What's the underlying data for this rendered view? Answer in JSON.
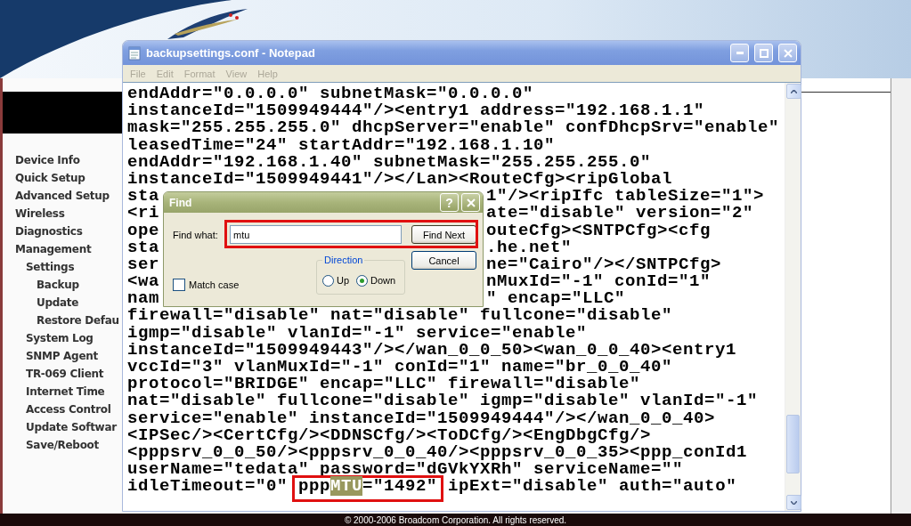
{
  "page": {
    "nav": [
      {
        "label": "Device Info"
      },
      {
        "label": "Quick Setup"
      },
      {
        "label": "Advanced Setup"
      },
      {
        "label": "Wireless"
      },
      {
        "label": "Diagnostics"
      },
      {
        "label": "Management",
        "children": [
          {
            "label": "Settings",
            "children": [
              {
                "label": "Backup"
              },
              {
                "label": "Update"
              },
              {
                "label": "Restore Defau"
              }
            ]
          },
          {
            "label": "System Log"
          },
          {
            "label": "SNMP Agent"
          },
          {
            "label": "TR-069 Client"
          },
          {
            "label": "Internet Time"
          },
          {
            "label": "Access Control"
          },
          {
            "label": "Update Softwar"
          },
          {
            "label": "Save/Reboot"
          }
        ]
      }
    ],
    "footer": "© 2000-2006 Broadcom Corporation. All rights reserved."
  },
  "notepad": {
    "title": "backupsettings.conf - Notepad",
    "menu": [
      "File",
      "Edit",
      "Format",
      "View",
      "Help"
    ],
    "lines": [
      {
        "kind": "full",
        "text": "endAddr=\"0.0.0.0\" subnetMask=\"0.0.0.0\""
      },
      {
        "kind": "full",
        "text": "instanceId=\"1509949444\"/><entry1 address=\"192.168.1.1\""
      },
      {
        "kind": "full",
        "text": "mask=\"255.255.255.0\" dhcpServer=\"enable\" confDhcpSrv=\"enable\""
      },
      {
        "kind": "full",
        "text": "leasedTime=\"24\" startAddr=\"192.168.1.10\""
      },
      {
        "kind": "full",
        "text": "endAddr=\"192.168.1.40\" subnetMask=\"255.255.255.0\""
      },
      {
        "kind": "full",
        "text": "instanceId=\"1509949441\"/></Lan><RouteCfg><ripGlobal"
      },
      {
        "kind": "split",
        "left": "sta",
        "right": "1\"/><ripIfc tableSize=\"1\">"
      },
      {
        "kind": "split",
        "left": "<ri",
        "right": "ate=\"disable\" version=\"2\""
      },
      {
        "kind": "split",
        "left": "ope",
        "right": "outeCfg><SNTPCfg><cfg"
      },
      {
        "kind": "split",
        "left": "sta",
        "right": ".he.net\""
      },
      {
        "kind": "split",
        "left": "ser",
        "right": "ne=\"Cairo\"/></SNTPCfg>"
      },
      {
        "kind": "split",
        "left": "<wa",
        "right": "nMuxId=\"-1\" conId=\"1\""
      },
      {
        "kind": "split",
        "left": "nam",
        "right": "\" encap=\"LLC\""
      },
      {
        "kind": "full",
        "text": "firewall=\"disable\" nat=\"disable\" fullcone=\"disable\""
      },
      {
        "kind": "full",
        "text": "igmp=\"disable\" vlanId=\"-1\" service=\"enable\""
      },
      {
        "kind": "full",
        "text": "instanceId=\"1509949443\"/></wan_0_0_50><wan_0_0_40><entry1"
      },
      {
        "kind": "full",
        "text": "vccId=\"3\" vlanMuxId=\"-1\" conId=\"1\" name=\"br_0_0_40\""
      },
      {
        "kind": "full",
        "text": "protocol=\"BRIDGE\" encap=\"LLC\" firewall=\"disable\""
      },
      {
        "kind": "full",
        "text": "nat=\"disable\" fullcone=\"disable\" igmp=\"disable\" vlanId=\"-1\""
      },
      {
        "kind": "full",
        "text": "service=\"enable\" instanceId=\"1509949444\"/></wan_0_0_40>"
      },
      {
        "kind": "full",
        "text": "<IPSec/><CertCfg/><DDNSCfg/><ToDCfg/><EngDbgCfg/>"
      },
      {
        "kind": "full",
        "text": "<pppsrv_0_0_50/><pppsrv_0_0_40/><pppsrv_0_0_35><ppp_conId1"
      },
      {
        "kind": "full",
        "text": "userName=\"tedata\" password=\"dGVkYXRh\" serviceName=\"\""
      },
      {
        "kind": "marked",
        "before": "idleTimeout=\"0\" ",
        "segments": [
          {
            "text": "ppp",
            "selected": false
          },
          {
            "text": "MTU",
            "selected": true
          },
          {
            "text": "=\"1492\"",
            "selected": false
          }
        ],
        "after": " ipExt=\"disable\" auth=\"auto\""
      }
    ]
  },
  "find_dialog": {
    "title": "Find",
    "help": "?",
    "find_what_label": "Find what:",
    "find_what_value": "mtu",
    "buttons": [
      "Find Next",
      "Cancel"
    ],
    "direction": {
      "label": "Direction",
      "options": [
        {
          "label": "Up",
          "selected": false
        },
        {
          "label": "Down",
          "selected": true
        }
      ]
    },
    "match_case": {
      "label": "Match case",
      "checked": false
    }
  }
}
